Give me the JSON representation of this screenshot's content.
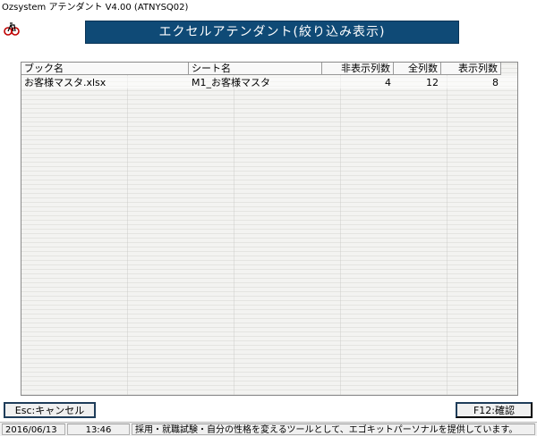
{
  "window": {
    "title": "Ozsystem アテンダント V4.00 (ATNYSQ02)"
  },
  "icons": {
    "app": "bicycle-icon"
  },
  "banner": {
    "title": "エクセルアテンダント(絞り込み表示)"
  },
  "table": {
    "headers": {
      "book": "ブック名",
      "sheet": "シート名",
      "hidden": "非表示列数",
      "total": "全列数",
      "shown": "表示列数"
    },
    "rows": [
      {
        "book": "お客様マスタ.xlsx",
        "sheet": "M1_お客様マスタ",
        "hidden": "4",
        "total": "12",
        "shown": "8"
      }
    ]
  },
  "buttons": {
    "cancel": "Esc:キャンセル",
    "confirm": "F12:確認"
  },
  "status": {
    "date": "2016/06/13",
    "time": "13:46",
    "message": "採用・就職試験・自分の性格を変えるツールとして、エゴキットパーソナルを提供しています。"
  },
  "colors": {
    "banner_bg": "#0f4a76",
    "banner_text": "#ffffff"
  }
}
